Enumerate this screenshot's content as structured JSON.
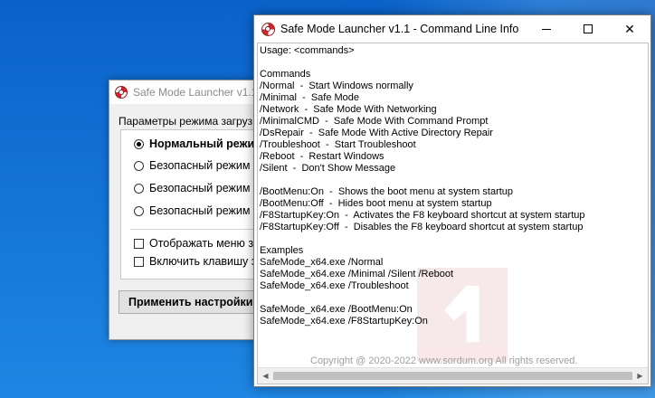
{
  "colors": {
    "desktop": "#1e86e2",
    "brand_red": "#d6242b"
  },
  "back_window": {
    "title": "Safe Mode Launcher v1.1",
    "group_label": "Параметры режима загруз",
    "options": [
      {
        "label": "Нормальный режи",
        "selected": true
      },
      {
        "label": "Безопасный режим",
        "selected": false
      },
      {
        "label": "Безопасный режим с",
        "selected": false
      },
      {
        "label": "Безопасный режим т",
        "selected": false
      }
    ],
    "checks": [
      {
        "label": "Отображать меню за",
        "checked": false
      },
      {
        "label": "Включить клавишу за",
        "checked": false
      }
    ],
    "apply_label": "Применить настройки"
  },
  "front_window": {
    "title": "Safe Mode Launcher v1.1 - Command Line Info",
    "lines": [
      "Usage: <commands>",
      "",
      "Commands",
      "/Normal  -  Start Windows normally",
      "/Minimal  -  Safe Mode",
      "/Network  -  Safe Mode With Networking",
      "/MinimalCMD  -  Safe Mode With Command Prompt",
      "/DsRepair  -  Safe Mode With Active Directory Repair",
      "/Troubleshoot  -  Start Troubleshoot",
      "/Reboot  -  Restart Windows",
      "/Silent  -  Don't Show Message",
      "",
      "/BootMenu:On  -  Shows the boot menu at system startup",
      "/BootMenu:Off  -  Hides boot menu at system startup",
      "/F8StartupKey:On  -  Activates the F8 keyboard shortcut at system startup",
      "/F8StartupKey:Off  -  Disables the F8 keyboard shortcut at system startup",
      "",
      "Examples",
      "SafeMode_x64.exe /Normal",
      "SafeMode_x64.exe /Minimal /Silent /Reboot",
      "SafeMode_x64.exe /Troubleshoot",
      "",
      "SafeMode_x64.exe /BootMenu:On",
      "SafeMode_x64.exe /F8StartupKey:On"
    ],
    "copyright": "Copyright @ 2020-2022 www.sordum.org All rights reserved.",
    "close_glyph": "✕"
  }
}
